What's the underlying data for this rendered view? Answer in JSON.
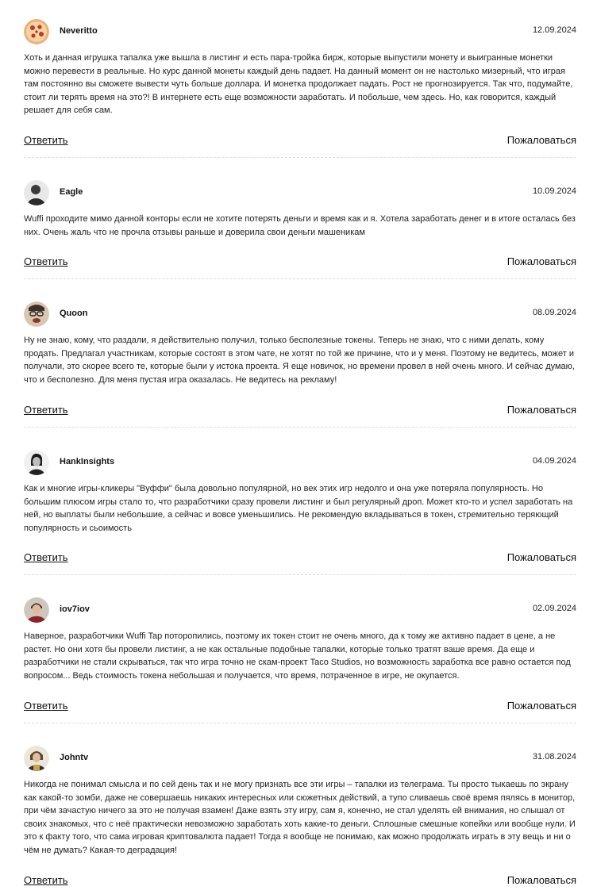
{
  "comments": [
    {
      "author": "Neveritto",
      "date": "12.09.2024",
      "text": "Хоть и данная игрушка тапалка уже вышла в листинг и есть пара-тройка бирж, которые выпустили монету и выигранные монетки можно перевести в реальные. Но курс данной монеты каждый день падает. На данный момент он не настолько мизерный, что играя там постоянно вы сможете вывести чуть больше доллара. И монетка продолжает падать. Рост не прогнозируется. Так что, подумайте, стоит ли терять время на это?! В интернете есть еще возможности заработать. И побольше, чем здесь. Но, как говорится, каждый решает для себя сам.",
      "reply_label": "Ответить",
      "report_label": "Пожаловаться"
    },
    {
      "author": "Eagle",
      "date": "10.09.2024",
      "text": "Wuffi проходите мимо данной конторы если не хотите потерять деньги и время как и я. Хотела заработать денег и в итоге осталась без них. Очень жаль что не прочла отзывы раньше и доверила свои деньги машеникам",
      "reply_label": "Ответить",
      "report_label": "Пожаловаться"
    },
    {
      "author": "Quoon",
      "date": "08.09.2024",
      "text": "Ну не знаю, кому, что раздали, я действительно получил, только бесполезные токены. Теперь не знаю, что с ними делать, кому продать. Предлагал участникам, которые состоят в этом чате, не хотят по той же причине, что и у меня. Поэтому не ведитесь, может и получали, это скорее всего те, которые были у истока проекта. Я еще новичок, но времени провел в ней очень много. И сейчас думаю, что и бесполезно. Для меня пустая игра оказалась. Не ведитесь на рекламу!",
      "reply_label": "Ответить",
      "report_label": "Пожаловаться"
    },
    {
      "author": "HankInsights",
      "date": "04.09.2024",
      "text": "Как и многие игры-кликеры \"Вуффи\" была довольно популярной, но век этих игр недолго и она уже потеряла популярность. Но большим плюсом игры стало то, что разработчики сразу провели листинг и был регулярный дроп. Может кто-то и успел заработать на ней, но выплаты были небольшие, а сейчас и вовсе уменьшились. Не рекомендую вкладываться в токен, стремительно теряющий популярность и сьоимость",
      "reply_label": "Ответить",
      "report_label": "Пожаловаться"
    },
    {
      "author": "iov7iov",
      "date": "02.09.2024",
      "text": "Наверное, разработчики Wuffi Tap поторопились, поэтому их токен стоит не очень много, да к тому же активно падает в цене, а не растет. Но они хотя бы провели листинг, а не как остальные подобные тапалки, которые только тратят ваше время. Да еще и разработчики не стали скрываться, так что игра точно не скам-проект Taco Studios, но возможность заработка все равно остается под вопросом... Ведь стоимость токена небольшая и получается, что время, потраченное в игре, не окупается.",
      "reply_label": "Ответить",
      "report_label": "Пожаловаться"
    },
    {
      "author": "Johntv",
      "date": "31.08.2024",
      "text": "Никогда не понимал смысла и по сей день так и не могу признать все эти игры – тапалки из телеграма. Ты просто тыкаешь по экрану как какой-то зомби, даже не совершаешь никаких интересных или сюжетных действий, а тупо сливаешь своё время пялясь в монитор, при чём зачастую ничего за это не получая взамен! Даже взять эту игру, сам я, конечно, не стал уделять ей внимания, но слышал от своих знакомых, что с неё практически невозможно заработать хоть какие-то деньги. Сплошные смешные копейки или вообще нули. И это к факту того, что сама игровая криптовалюта падает! Тогда я вообще не понимаю, как можно продолжать играть в эту вещь и ни о чём не думать? Какая-то деградация!",
      "reply_label": "Ответить",
      "report_label": "Пожаловаться"
    }
  ]
}
